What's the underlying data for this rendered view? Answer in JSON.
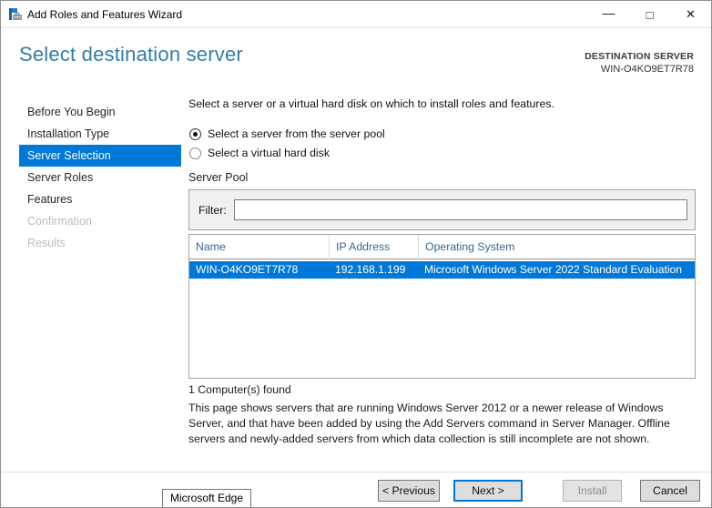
{
  "window": {
    "title": "Add Roles and Features Wizard",
    "controls": {
      "minimize": "—",
      "maximize": "□",
      "close": "✕"
    }
  },
  "header": {
    "title": "Select destination server",
    "destination_label": "DESTINATION SERVER",
    "destination_server": "WIN-O4KO9ET7R78"
  },
  "sidebar": {
    "items": [
      {
        "label": "Before You Begin",
        "state": "normal"
      },
      {
        "label": "Installation Type",
        "state": "normal"
      },
      {
        "label": "Server Selection",
        "state": "selected"
      },
      {
        "label": "Server Roles",
        "state": "normal"
      },
      {
        "label": "Features",
        "state": "normal"
      },
      {
        "label": "Confirmation",
        "state": "disabled"
      },
      {
        "label": "Results",
        "state": "disabled"
      }
    ]
  },
  "main": {
    "intro": "Select a server or a virtual hard disk on which to install roles and features.",
    "radios": [
      {
        "label": "Select a server from the server pool",
        "selected": true
      },
      {
        "label": "Select a virtual hard disk",
        "selected": false
      }
    ],
    "server_pool": {
      "title": "Server Pool",
      "filter_label": "Filter:",
      "filter_value": "",
      "table": {
        "columns": [
          "Name",
          "IP Address",
          "Operating System"
        ],
        "rows": [
          {
            "name": "WIN-O4KO9ET7R78",
            "ip": "192.168.1.199",
            "os": "Microsoft Windows Server 2022 Standard Evaluation",
            "selected": true
          }
        ]
      },
      "count_text": "1 Computer(s) found"
    },
    "description": "This page shows servers that are running Windows Server 2012 or a newer release of Windows Server, and that have been added by using the Add Servers command in Server Manager. Offline servers and newly-added servers from which data collection is still incomplete are not shown."
  },
  "footer": {
    "buttons": [
      {
        "label": "< Previous",
        "state": "enabled",
        "default": false
      },
      {
        "label": "Next >",
        "state": "enabled",
        "default": true
      },
      {
        "label": "Install",
        "state": "disabled",
        "default": false
      },
      {
        "label": "Cancel",
        "state": "enabled",
        "default": false
      }
    ]
  },
  "tooltip": {
    "text": "Microsoft Edge"
  },
  "colors": {
    "accent": "#0078d7",
    "heading": "#337da8",
    "table_header_text": "#33679e",
    "selected_row_bg": "#0078d7"
  }
}
